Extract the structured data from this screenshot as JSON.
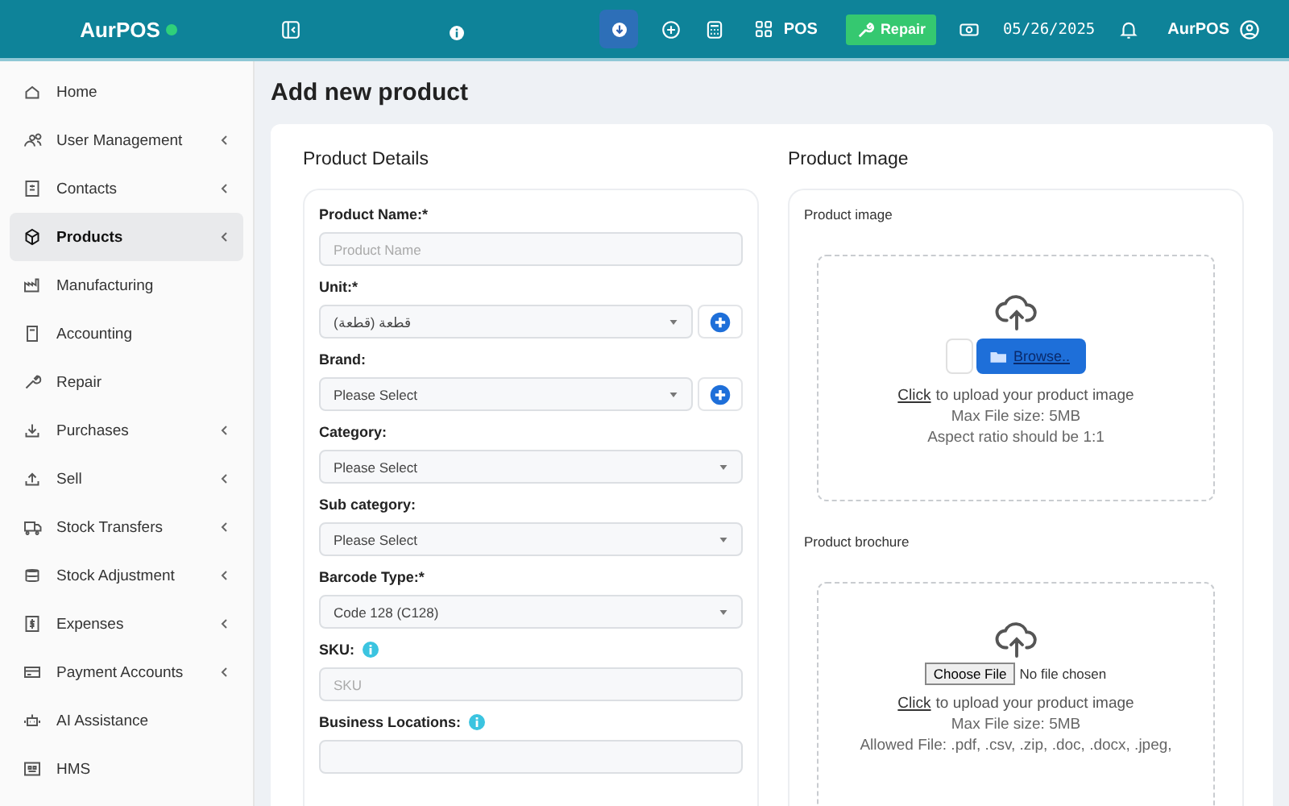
{
  "header": {
    "brand": "AurPOS",
    "pos_label": "POS",
    "repair_label": "Repair",
    "date": "05/26/2025",
    "user": "AurPOS"
  },
  "sidebar": {
    "items": [
      {
        "label": "Home",
        "expandable": false,
        "selected": false
      },
      {
        "label": "User Management",
        "expandable": true,
        "selected": false
      },
      {
        "label": "Contacts",
        "expandable": true,
        "selected": false
      },
      {
        "label": "Products",
        "expandable": true,
        "selected": true
      },
      {
        "label": "Manufacturing",
        "expandable": false,
        "selected": false
      },
      {
        "label": "Accounting",
        "expandable": false,
        "selected": false
      },
      {
        "label": "Repair",
        "expandable": false,
        "selected": false
      },
      {
        "label": "Purchases",
        "expandable": true,
        "selected": false
      },
      {
        "label": "Sell",
        "expandable": true,
        "selected": false
      },
      {
        "label": "Stock Transfers",
        "expandable": true,
        "selected": false
      },
      {
        "label": "Stock Adjustment",
        "expandable": true,
        "selected": false
      },
      {
        "label": "Expenses",
        "expandable": true,
        "selected": false
      },
      {
        "label": "Payment Accounts",
        "expandable": true,
        "selected": false
      },
      {
        "label": "AI Assistance",
        "expandable": false,
        "selected": false
      },
      {
        "label": "HMS",
        "expandable": false,
        "selected": false
      }
    ]
  },
  "page_title": "Add new product",
  "details": {
    "title": "Product Details",
    "fields": [
      {
        "label": "Product Name:*",
        "kind": "input",
        "placeholder": "Product Name",
        "info": false
      },
      {
        "label": "Unit:*",
        "kind": "select",
        "value": "قطعة (قطعة)",
        "addable": true,
        "info": false
      },
      {
        "label": "Brand:",
        "kind": "select",
        "value": "Please Select",
        "addable": true,
        "info": false
      },
      {
        "label": "Category:",
        "kind": "select",
        "value": "Please Select",
        "addable": false,
        "info": false
      },
      {
        "label": "Sub category:",
        "kind": "select",
        "value": "Please Select",
        "addable": false,
        "info": false
      },
      {
        "label": "Barcode Type:*",
        "kind": "select",
        "value": "Code 128 (C128)",
        "addable": false,
        "info": false
      },
      {
        "label": "SKU:",
        "kind": "input",
        "placeholder": "SKU",
        "info": true
      },
      {
        "label": "Business Locations:",
        "kind": "input",
        "info": true
      }
    ]
  },
  "media": {
    "title": "Product Image",
    "uploads": [
      {
        "label": "Product image",
        "kind": "browse",
        "button": "Browse..",
        "link": "Click",
        "text": "to upload your product image",
        "notes": [
          "Max File size: 5MB",
          "Aspect ratio should be 1:1"
        ]
      },
      {
        "label": "Product brochure",
        "kind": "file",
        "button": "Choose File",
        "status": "No file chosen",
        "link": "Click",
        "text": "to upload your product image",
        "notes": [
          "Max File size: 5MB",
          "Allowed File: .pdf, .csv, .zip, .doc, .docx, .jpeg,"
        ]
      }
    ]
  }
}
